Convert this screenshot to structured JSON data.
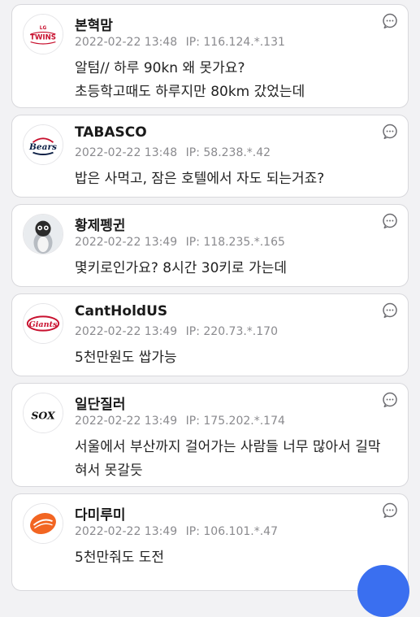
{
  "comments": [
    {
      "author": "본혁맘",
      "date": "2022-02-22 13:48",
      "ip_label": "IP:",
      "ip": "116.124.*.131",
      "lines": [
        "알텀// 하루 90kn 왜 못가요?",
        "초등학고때도 하루지만 80km 갔었는데"
      ],
      "avatar_icon": "twins-logo-icon",
      "avatar_text": "TWINS"
    },
    {
      "author": "TABASCO",
      "date": "2022-02-22 13:48",
      "ip_label": "IP:",
      "ip": "58.238.*.42",
      "lines": [
        "밥은 사먹고, 잠은 호텔에서 자도 되는거죠?"
      ],
      "avatar_icon": "bears-logo-icon",
      "avatar_text": "Bears"
    },
    {
      "author": "황제펭귄",
      "date": "2022-02-22 13:49",
      "ip_label": "IP:",
      "ip": "118.235.*.165",
      "lines": [
        "몇키로인가요? 8시간 30키로 가는데"
      ],
      "avatar_icon": "penguin-icon",
      "avatar_text": ""
    },
    {
      "author": "CantHoldUS",
      "date": "2022-02-22 13:49",
      "ip_label": "IP:",
      "ip": "220.73.*.170",
      "lines": [
        "5천만원도 쌉가능"
      ],
      "avatar_icon": "giants-logo-icon",
      "avatar_text": "Giants"
    },
    {
      "author": "일단질러",
      "date": "2022-02-22 13:49",
      "ip_label": "IP:",
      "ip": "175.202.*.174",
      "lines": [
        "서울에서 부산까지 걸어가는 사람들 너무 많아서 길막",
        "혀서 못갈듯"
      ],
      "avatar_icon": "white-sox-logo-icon",
      "avatar_text": "SOX"
    },
    {
      "author": "다미루미",
      "date": "2022-02-22 13:49",
      "ip_label": "IP:",
      "ip": "106.101.*.47",
      "lines": [
        "5천만줘도 도전"
      ],
      "avatar_icon": "orange-ball-logo-icon",
      "avatar_text": ""
    }
  ],
  "colors": {
    "background": "#f2f2f4",
    "card": "#ffffff",
    "border": "#d8d8dc",
    "meta_text": "#8a8a8e",
    "fab": "#3a6ff0"
  },
  "icons": {
    "reply": "comment-bubble-icon",
    "fab": "floating-action-button"
  }
}
